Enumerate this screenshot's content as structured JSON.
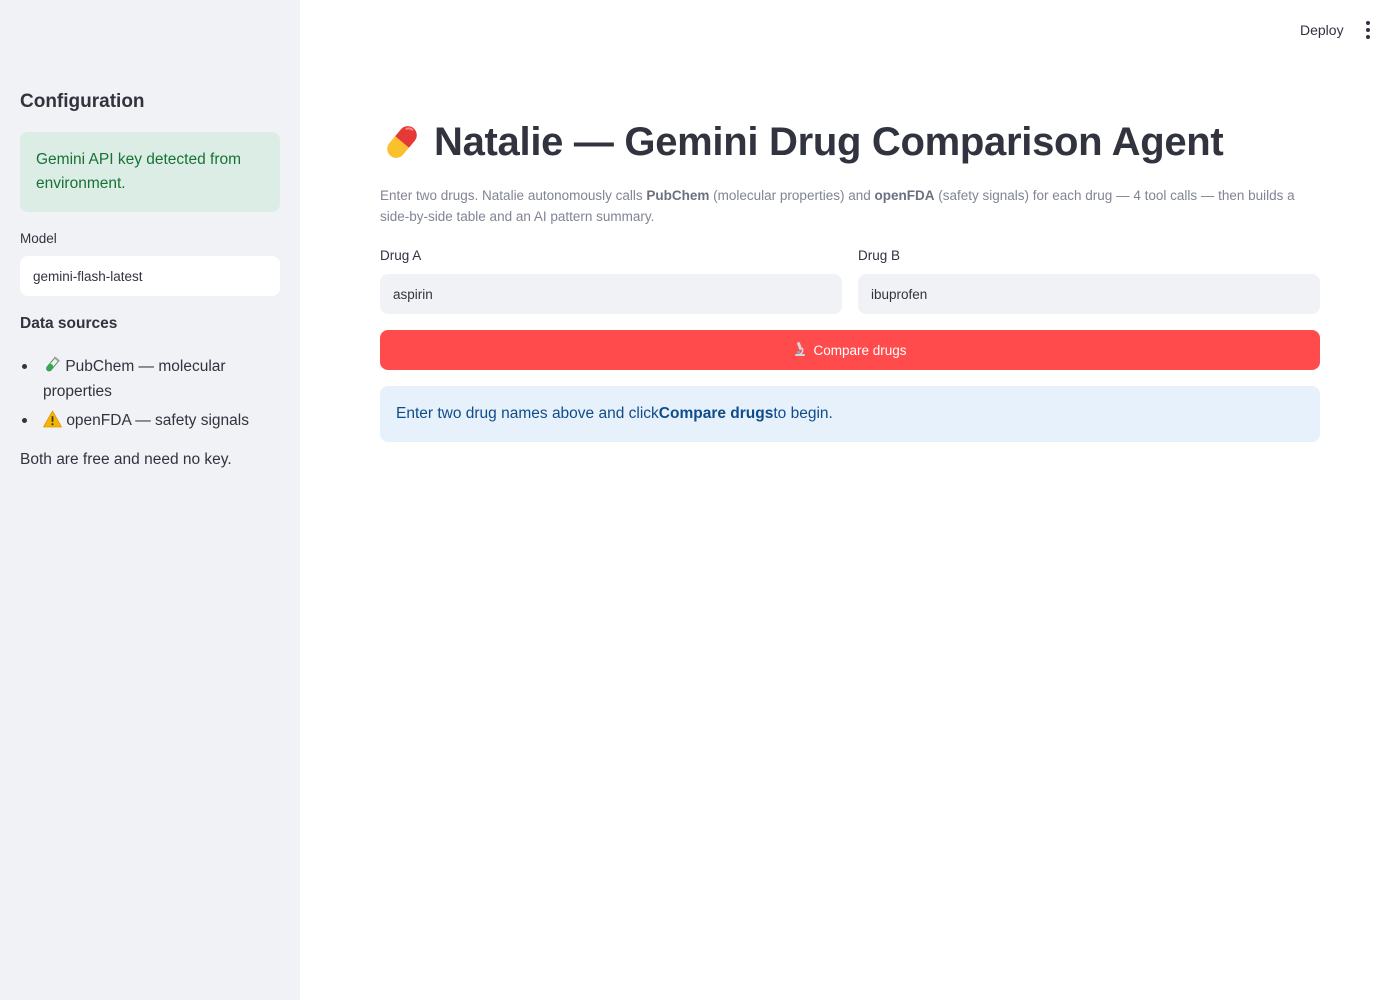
{
  "header": {
    "deploy_label": "Deploy",
    "menu_icon": "kebab-menu-icon"
  },
  "sidebar": {
    "title": "Configuration",
    "api_status": "Gemini API key detected from environment.",
    "model_label": "Model",
    "model_value": "gemini-flash-latest",
    "data_sources_title": "Data sources",
    "data_sources": [
      {
        "icon": "test-tube-icon",
        "label": "PubChem — molecular properties"
      },
      {
        "icon": "warning-icon",
        "label": "openFDA — safety signals"
      }
    ],
    "note": "Both are free and need no key."
  },
  "main": {
    "title_icon": "pill-icon",
    "title": "Natalie — Gemini Drug Comparison Agent",
    "description": {
      "part1": "Enter two drugs. Natalie autonomously calls ",
      "bold1": "PubChem",
      "part2": " (molecular properties) and ",
      "bold2": "openFDA",
      "part3": " (safety signals) for each drug — 4 tool calls — then builds a side-by-side table and an AI pattern summary."
    },
    "drug_a": {
      "label": "Drug A",
      "value": "aspirin"
    },
    "drug_b": {
      "label": "Drug B",
      "value": "ibuprofen"
    },
    "compare_button": {
      "icon": "microscope-icon",
      "label": "Compare drugs"
    },
    "info": {
      "part1": "Enter two drug names above and click ",
      "bold": "Compare drugs",
      "part2": " to begin."
    }
  },
  "colors": {
    "sidebar_bg": "#f0f2f6",
    "primary": "#ff4b4b",
    "success_bg": "#dcede6",
    "success_text": "#177233",
    "info_bg": "#e7f1fc",
    "info_text": "#0f4c8a",
    "text": "#31333f"
  }
}
